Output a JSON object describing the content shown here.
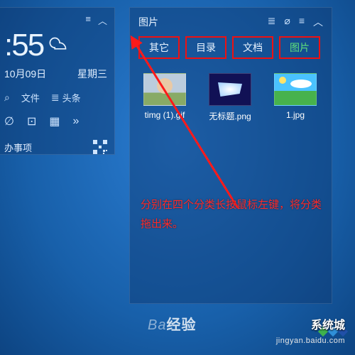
{
  "left": {
    "menu_glyph": "≡",
    "collapse_glyph": "︿",
    "time": ":55",
    "date": "10月09日",
    "weekday": "星期三",
    "search_glyph": "⌕",
    "files_label": "文件",
    "headlines_glyph": "≣",
    "headlines_label": "头条",
    "row4_a": "∅",
    "row4_b": "⊡",
    "row4_c": "▦",
    "row4_more": "»",
    "todo": "办事项"
  },
  "panel": {
    "title": "图片",
    "header_icons": {
      "list": "≣",
      "lock": "⌀",
      "menu": "≡",
      "collapse": "︿"
    },
    "tabs": [
      {
        "label": "其它",
        "active": false
      },
      {
        "label": "目录",
        "active": false
      },
      {
        "label": "文档",
        "active": false
      },
      {
        "label": "图片",
        "active": true
      }
    ],
    "items": [
      {
        "name": "timg (1).gif",
        "kind": "gif"
      },
      {
        "name": "无标题.png",
        "kind": "png"
      },
      {
        "name": "1.jpg",
        "kind": "jpg"
      }
    ]
  },
  "annotation": "分别在四个分类长按鼠标左键，将分类拖出来。",
  "watermark_center_prefix": "Ba",
  "watermark_center_suffix": "经验",
  "watermark_right": "系统城",
  "watermark_url": "jingyan.baidu.com"
}
